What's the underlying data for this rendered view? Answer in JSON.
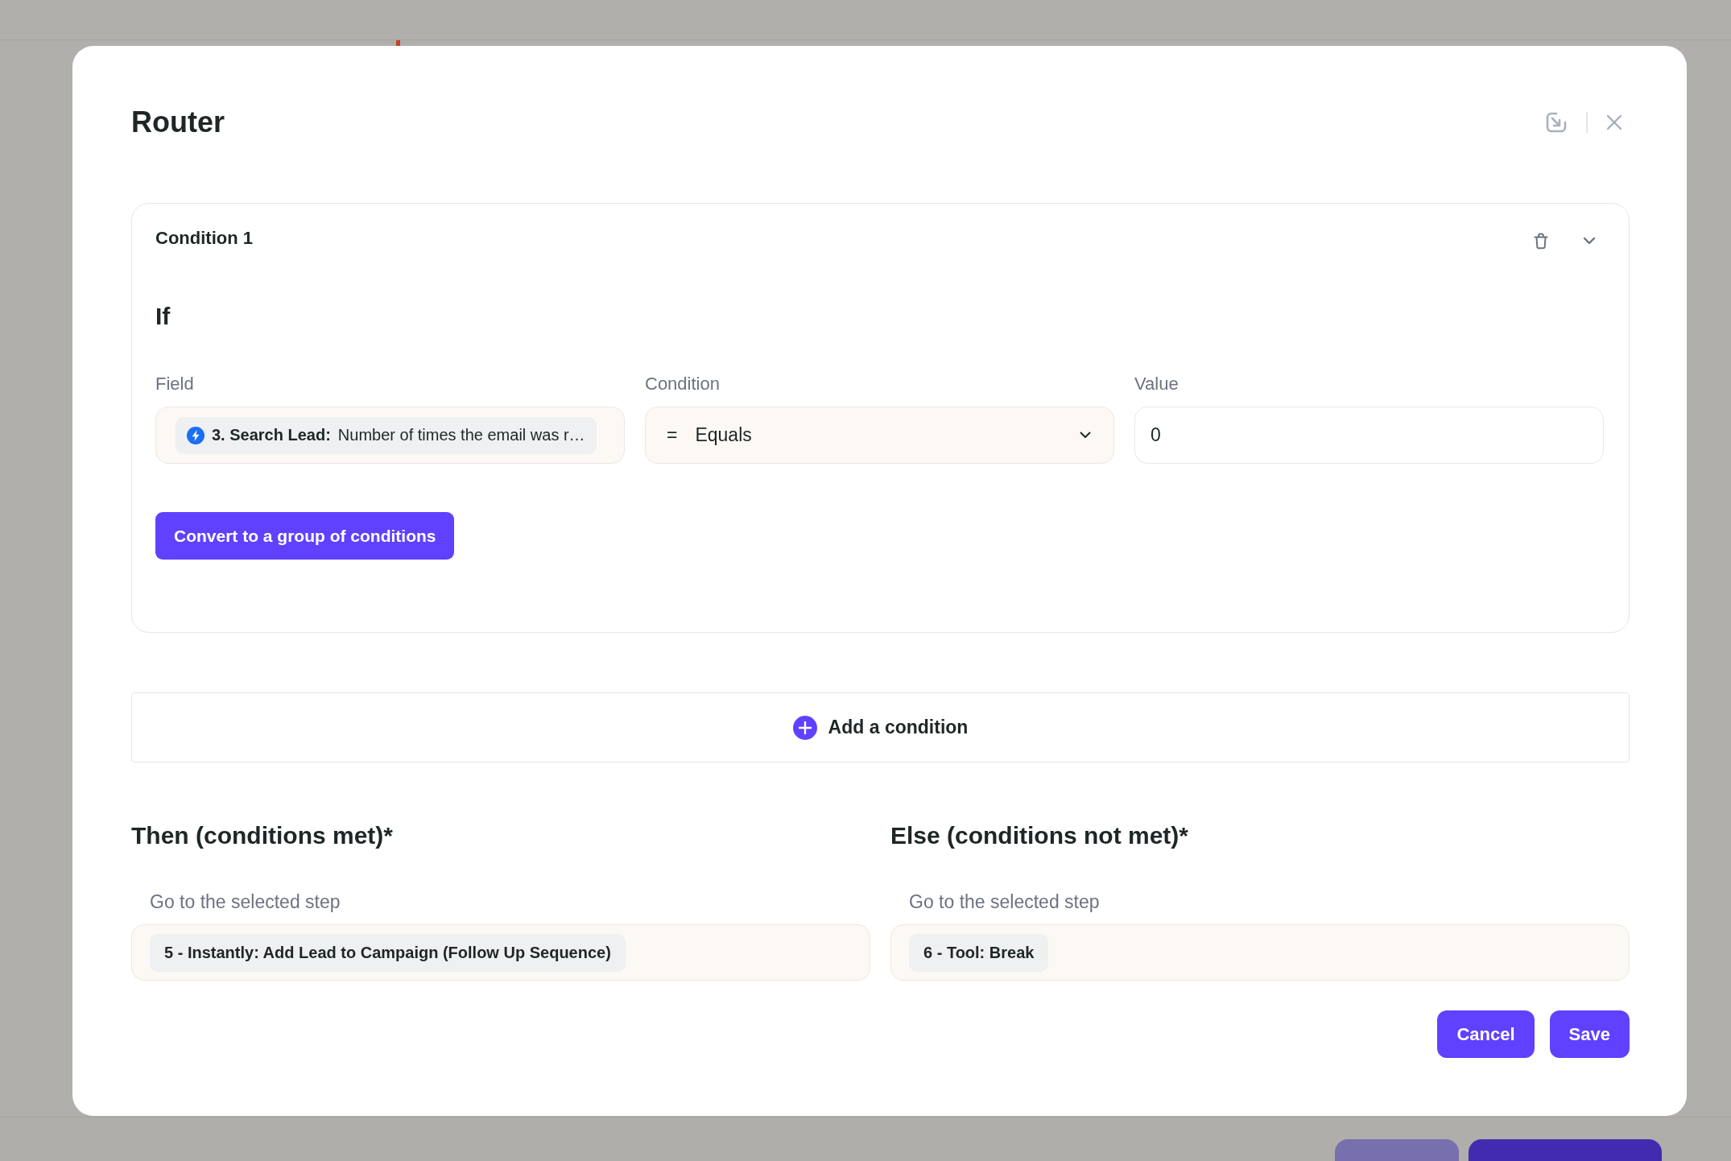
{
  "dialog": {
    "title": "Router",
    "conditions": [
      {
        "title": "Condition 1",
        "expanded": true,
        "heading": "If",
        "fields": [
          {
            "kind": "token",
            "label": "Field",
            "value": "**3. Search Lead:** Number of times the email was r…"
          },
          {
            "kind": "select",
            "label": "Condition",
            "symbol": "=",
            "value": "Equals"
          },
          {
            "kind": "text",
            "label": "Value",
            "value": "0"
          }
        ],
        "convert_button": "Convert to a group of conditions"
      }
    ],
    "add_condition": "Add a condition",
    "branches": [
      {
        "title": "Then (conditions met)*",
        "label": "Go to the selected step",
        "step": "5 - Instantly: Add Lead to Campaign (Follow Up Sequence)"
      },
      {
        "title": "Else (conditions not met)*",
        "label": "Go to the selected step",
        "step": "6 - Tool: Break"
      }
    ],
    "buttons": [
      "Cancel",
      "Save"
    ]
  }
}
